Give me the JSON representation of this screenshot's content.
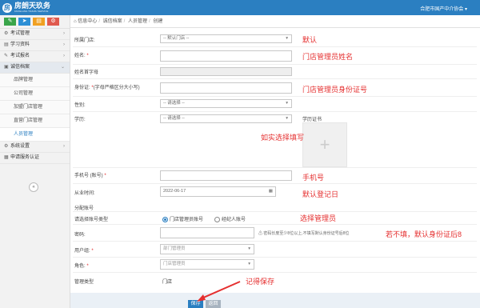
{
  "header": {
    "logo_glyph": "房",
    "logo_title": "房朗天玖务",
    "logo_sub": "FANGLANG TIANJIU SERVICE",
    "org": "合肥市国产中介协会"
  },
  "sidebar": {
    "quick_buttons": [
      {
        "icon": "edit-icon",
        "glyph": "✎",
        "color": "#3aa54a"
      },
      {
        "icon": "send-icon",
        "glyph": "➤",
        "color": "#2d8fd5"
      },
      {
        "icon": "chart-icon",
        "glyph": "▤",
        "color": "#f0a021"
      },
      {
        "icon": "gear-icon",
        "glyph": "⚙",
        "color": "#e05a4e"
      }
    ],
    "items": [
      {
        "label": "考试管理",
        "glyph": "⚙"
      },
      {
        "label": "学习资料",
        "glyph": "▤"
      },
      {
        "label": "考试报名",
        "glyph": "✎"
      },
      {
        "label": "诚信档案",
        "glyph": "▣"
      }
    ],
    "sub_items": [
      "品牌管理",
      "公司管理",
      "加盟门店管理",
      "直营门店管理",
      "人员管理"
    ],
    "items_after": [
      {
        "label": "系统设置",
        "glyph": "⚙"
      },
      {
        "label": "申请服务认证",
        "glyph": "▦"
      }
    ],
    "collapse_glyph": "«"
  },
  "breadcrumb": {
    "home_icon": "⌂",
    "items": [
      "信息中心",
      "诚信档案",
      "人员管理",
      "创建"
    ],
    "sep": "/"
  },
  "form": {
    "store_label": "所属门店:",
    "store_value": "-- 默认门店 --",
    "name_label": "姓名:",
    "pinyin_label": "姓名首字母",
    "idcard_label": "身份证:",
    "idcard_hint": "(字母严格区分大小写)",
    "gender_label": "性别:",
    "gender_value": "-- 请选择 --",
    "edu_label": "学历:",
    "edu_value": "-- 请选择 --",
    "cert_label": "学历证书",
    "upload_glyph": "+",
    "phone_label": "手机号 (账号)",
    "date_label": "从业时间:",
    "date_value": "2022-06-17",
    "cal_glyph": "▦",
    "group_label": "分配账号",
    "acct_type_label": "请选择账号类型",
    "acct_opt1": "门店管理员账号",
    "acct_opt2": "经纪人账号",
    "pwd_label": "密码:",
    "pwd_hint": "密码长度至少8位以上,不填写默认身份证号后8位",
    "pwd_hint_icon": "⚠",
    "usergroup_label": "用户组:",
    "usergroup_value": "部门管理员",
    "role_label": "角色:",
    "role_value": "门店管理员",
    "mgr_type_label": "管理类型",
    "mgr_type_value": "门店",
    "caret": "▾"
  },
  "buttons": {
    "save": "保存",
    "back": "返回"
  },
  "annotations": {
    "default": "默认",
    "admin_name": "门店管理员姓名",
    "admin_id": "门店管理员身份证号",
    "fill": "如实选择填写",
    "phone": "手机号",
    "date": "默认登记日",
    "choose": "选择管理员",
    "pwd": "若不填，默认身份证后8",
    "save": "记得保存"
  },
  "colors": {
    "brand": "#2b7fc1",
    "annotation": "#e53030",
    "save": "#2b7fc1",
    "back": "#a8b4c0"
  }
}
